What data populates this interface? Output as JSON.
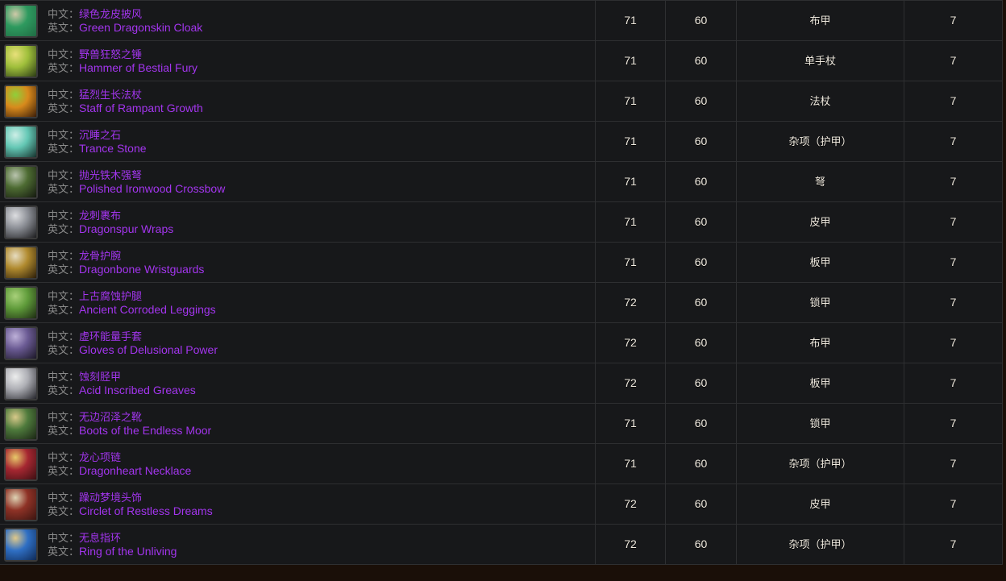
{
  "theme": {
    "page_background": "#1a0f08",
    "row_background": "#17181a",
    "border_color": "#2e2f31",
    "epic_quality_color": "#a335ee",
    "label_color": "#8a8a8a",
    "value_color": "#f2ece1"
  },
  "labels": {
    "chinese_label": "中文：",
    "english_label": "英文："
  },
  "rows": [
    {
      "icon": "green-dragonskin-cloak-icon",
      "name_cn": "绿色龙皮披风",
      "name_en": "Green Dragonskin Cloak",
      "item_level": "71",
      "required_level": "60",
      "type": "布甲",
      "num": "7",
      "icon_colors": {
        "base": "#1f6b43",
        "mid": "#2e9a5f",
        "hi": "#cfc9a8"
      }
    },
    {
      "icon": "hammer-of-bestial-fury-icon",
      "name_cn": "野兽狂怒之锤",
      "name_en": "Hammer of Bestial Fury",
      "item_level": "71",
      "required_level": "60",
      "type": "单手杖",
      "num": "7",
      "icon_colors": {
        "base": "#2a3a14",
        "mid": "#9fbf3b",
        "hi": "#e8e07a"
      }
    },
    {
      "icon": "staff-of-rampant-growth-icon",
      "name_cn": "猛烈生长法杖",
      "name_en": "Staff of Rampant Growth",
      "item_level": "71",
      "required_level": "60",
      "type": "法杖",
      "num": "7",
      "icon_colors": {
        "base": "#3a1c08",
        "mid": "#d88a1c",
        "hi": "#8fcf3a"
      }
    },
    {
      "icon": "trance-stone-icon",
      "name_cn": "沉睡之石",
      "name_en": "Trance Stone",
      "item_level": "71",
      "required_level": "60",
      "type": "杂项（护甲）",
      "num": "7",
      "icon_colors": {
        "base": "#16312c",
        "mid": "#63c7b4",
        "hi": "#cdeee6"
      }
    },
    {
      "icon": "polished-ironwood-crossbow-icon",
      "name_cn": "抛光铁木强弩",
      "name_en": "Polished Ironwood Crossbow",
      "item_level": "71",
      "required_level": "60",
      "type": "弩",
      "num": "7",
      "icon_colors": {
        "base": "#14180f",
        "mid": "#4d6b32",
        "hi": "#b9c4ae"
      }
    },
    {
      "icon": "dragonspur-wraps-icon",
      "name_cn": "龙刺裹布",
      "name_en": "Dragonspur Wraps",
      "item_level": "71",
      "required_level": "60",
      "type": "皮甲",
      "num": "7",
      "icon_colors": {
        "base": "#1b1b1d",
        "mid": "#8c8f96",
        "hi": "#dcdde0"
      }
    },
    {
      "icon": "dragonbone-wristguards-icon",
      "name_cn": "龙骨护腕",
      "name_en": "Dragonbone Wristguards",
      "item_level": "71",
      "required_level": "60",
      "type": "板甲",
      "num": "7",
      "icon_colors": {
        "base": "#2b1d09",
        "mid": "#b08a2e",
        "hi": "#e6dcc0"
      }
    },
    {
      "icon": "ancient-corroded-leggings-icon",
      "name_cn": "上古腐蚀护腿",
      "name_en": "Ancient Corroded Leggings",
      "item_level": "72",
      "required_level": "60",
      "type": "锁甲",
      "num": "7",
      "icon_colors": {
        "base": "#1d2a12",
        "mid": "#5f9b3a",
        "hi": "#a8d07a"
      }
    },
    {
      "icon": "gloves-of-delusional-power-icon",
      "name_cn": "虚环能量手套",
      "name_en": "Gloves of Delusional Power",
      "item_level": "72",
      "required_level": "60",
      "type": "布甲",
      "num": "7",
      "icon_colors": {
        "base": "#1b1726",
        "mid": "#6a5a93",
        "hi": "#bdb0d8"
      }
    },
    {
      "icon": "acid-inscribed-greaves-icon",
      "name_cn": "蚀刻胫甲",
      "name_en": "Acid Inscribed Greaves",
      "item_level": "72",
      "required_level": "60",
      "type": "板甲",
      "num": "7",
      "icon_colors": {
        "base": "#24242a",
        "mid": "#adaeb4",
        "hi": "#eceded"
      }
    },
    {
      "icon": "boots-of-the-endless-moor-icon",
      "name_cn": "无边沼泽之靴",
      "name_en": "Boots of the Endless Moor",
      "item_level": "71",
      "required_level": "60",
      "type": "锁甲",
      "num": "7",
      "icon_colors": {
        "base": "#1a2414",
        "mid": "#4e7a3c",
        "hi": "#d8c98a"
      }
    },
    {
      "icon": "dragonheart-necklace-icon",
      "name_cn": "龙心项链",
      "name_en": "Dragonheart Necklace",
      "item_level": "71",
      "required_level": "60",
      "type": "杂项（护甲）",
      "num": "7",
      "icon_colors": {
        "base": "#3b0f12",
        "mid": "#a52731",
        "hi": "#e8c96a"
      }
    },
    {
      "icon": "circlet-of-restless-dreams-icon",
      "name_cn": "躁动梦境头饰",
      "name_en": "Circlet of Restless Dreams",
      "item_level": "72",
      "required_level": "60",
      "type": "皮甲",
      "num": "7",
      "icon_colors": {
        "base": "#3a1410",
        "mid": "#8e3226",
        "hi": "#ded3b4"
      }
    },
    {
      "icon": "ring-of-the-unliving-icon",
      "name_cn": "无息指环",
      "name_en": "Ring of the Unliving",
      "item_level": "72",
      "required_level": "60",
      "type": "杂项（护甲）",
      "num": "7",
      "icon_colors": {
        "base": "#0f2a55",
        "mid": "#2f6fc4",
        "hi": "#e0c98a"
      }
    }
  ]
}
